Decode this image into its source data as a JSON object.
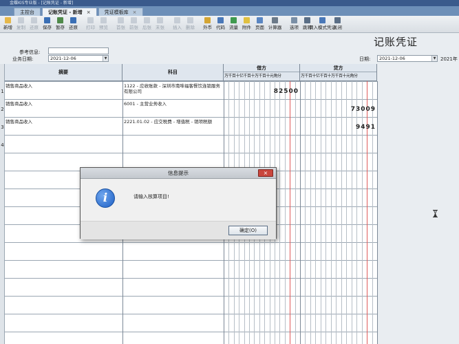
{
  "window": {
    "title": "金蝶KIS专业版 - [记账凭证 - 新增]"
  },
  "tabs": [
    {
      "label": "主控台",
      "active": false,
      "closable": false
    },
    {
      "label": "记账凭证 - 新增",
      "active": true,
      "closable": true
    },
    {
      "label": "凭证模板库",
      "active": false,
      "closable": true
    }
  ],
  "toolbar": [
    {
      "label": "新增",
      "icon": "new-icon",
      "color": "#e6b84a",
      "enabled": true
    },
    {
      "label": "复制",
      "icon": "copy-icon",
      "color": "#8a99aa",
      "enabled": false
    },
    {
      "label": "还原",
      "icon": "undo-icon",
      "color": "#8a99aa",
      "enabled": false
    },
    {
      "label": "保存",
      "icon": "save-icon",
      "color": "#3a6fb5",
      "enabled": true
    },
    {
      "label": "暂存",
      "icon": "stash-icon",
      "color": "#4f8a4a",
      "enabled": true
    },
    {
      "label": "还原",
      "icon": "restore-icon",
      "color": "#3a6fb5",
      "enabled": true
    },
    {
      "label": "打印",
      "icon": "print-icon",
      "color": "#8a99aa",
      "enabled": false
    },
    {
      "label": "预览",
      "icon": "preview-icon",
      "color": "#8a99aa",
      "enabled": false
    },
    {
      "label": "首张",
      "icon": "first-icon",
      "color": "#8a99aa",
      "enabled": false
    },
    {
      "label": "前张",
      "icon": "prev-icon",
      "color": "#8a99aa",
      "enabled": false
    },
    {
      "label": "后张",
      "icon": "next-icon",
      "color": "#8a99aa",
      "enabled": false
    },
    {
      "label": "末张",
      "icon": "last-icon",
      "color": "#8a99aa",
      "enabled": false
    },
    {
      "label": "插入",
      "icon": "insert-icon",
      "color": "#8a99aa",
      "enabled": false
    },
    {
      "label": "删除",
      "icon": "delete-icon",
      "color": "#8a99aa",
      "enabled": false
    },
    {
      "label": "外币",
      "icon": "currency-icon",
      "color": "#d4a533",
      "enabled": true
    },
    {
      "label": "代码",
      "icon": "code-icon",
      "color": "#4a78b8",
      "enabled": true
    },
    {
      "label": "流量",
      "icon": "flow-icon",
      "color": "#3f9a4f",
      "enabled": true
    },
    {
      "label": "附件",
      "icon": "attach-icon",
      "color": "#e0c040",
      "enabled": true
    },
    {
      "label": "页面",
      "icon": "page-icon",
      "color": "#5a86c2",
      "enabled": true
    },
    {
      "label": "计算器",
      "icon": "calculator-icon",
      "color": "#6c7a89",
      "enabled": true
    },
    {
      "label": "选项",
      "icon": "options-icon",
      "color": "#7a8fa6",
      "enabled": true
    },
    {
      "label": "跳转",
      "icon": "jump-icon",
      "color": "#5a6e86",
      "enabled": true
    },
    {
      "label": "调入模式凭证",
      "icon": "import-template-icon",
      "color": "#4a78b8",
      "enabled": true
    },
    {
      "label": "关闭",
      "icon": "close-icon",
      "color": "#5a6e86",
      "enabled": true
    }
  ],
  "header": {
    "doc_title": "记账凭证",
    "ref_label": "参考信息:",
    "ref_value": "",
    "biz_date_label": "业务日期:",
    "biz_date": "2021-12-06",
    "date_label": "日期:",
    "date": "2021-12-06",
    "date_extra": "2021年"
  },
  "grid": {
    "col_summary": "摘要",
    "col_account": "科目",
    "col_debit": "借方",
    "col_credit": "贷方",
    "units": "万千百十亿千百十万千百十元角分",
    "rows": [
      {
        "num": "1",
        "summary": "销售商品收入",
        "account": "1122 - 应收账款 - 深圳市南味福客餐饮连锁服务有限公司",
        "debit": "82500",
        "credit": ""
      },
      {
        "num": "2",
        "summary": "销售商品收入",
        "account": "6001 - 主营业务收入",
        "debit": "",
        "credit": "73009"
      },
      {
        "num": "3",
        "summary": "销售商品收入",
        "account": "2221.01.02 - 应交税费 - 增值税 - 销项税额",
        "debit": "",
        "credit": "9491"
      },
      {
        "num": "4",
        "summary": "",
        "account": "",
        "debit": "",
        "credit": ""
      }
    ]
  },
  "dialog": {
    "title": "信息提示",
    "message": "请输入核算项目!",
    "ok_label": "确定(O)",
    "close_label": "×"
  }
}
